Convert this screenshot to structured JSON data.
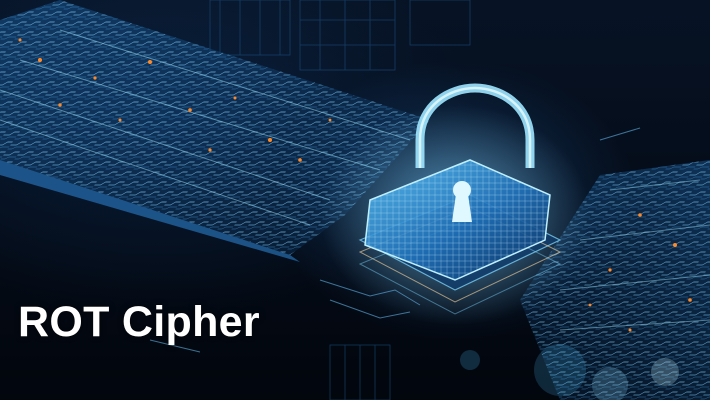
{
  "caption": {
    "title": "ROT Cipher"
  },
  "artwork": {
    "subject": "padlock-icon",
    "palette": {
      "background": "#040b17",
      "circuit_blue": "#3aa8ff",
      "glow_cyan": "#9fe6ff",
      "spark_orange": "#ff8a2a"
    }
  }
}
